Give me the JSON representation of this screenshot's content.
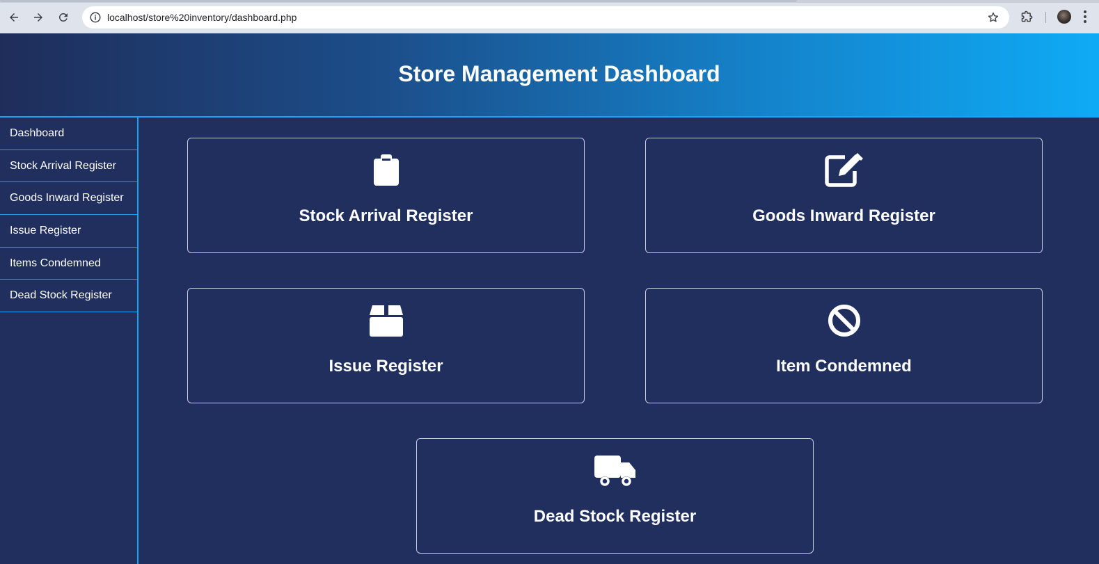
{
  "browser": {
    "url": "localhost/store%20inventory/dashboard.php",
    "icons": {
      "back": "back-arrow-icon",
      "forward": "forward-arrow-icon",
      "reload": "reload-icon",
      "info": "info-icon",
      "bookmark": "star-icon",
      "extensions": "puzzle-icon",
      "menu": "kebab-menu-icon"
    }
  },
  "header": {
    "title": "Store Management Dashboard"
  },
  "sidebar": {
    "items": [
      {
        "label": "Dashboard"
      },
      {
        "label": "Stock Arrival Register"
      },
      {
        "label": "Goods Inward Register"
      },
      {
        "label": "Issue Register"
      },
      {
        "label": "Items Condemned"
      },
      {
        "label": "Dead Stock Register"
      }
    ]
  },
  "cards": [
    {
      "title": "Stock Arrival Register",
      "icon": "clipboard-icon"
    },
    {
      "title": "Goods Inward Register",
      "icon": "edit-icon"
    },
    {
      "title": "Issue Register",
      "icon": "box-icon"
    },
    {
      "title": "Item Condemned",
      "icon": "ban-icon"
    },
    {
      "title": "Dead Stock Register",
      "icon": "truck-icon"
    }
  ],
  "colors": {
    "background": "#202f5e",
    "accent": "#1aa3f0",
    "header_gradient_start": "#1f2d5a",
    "header_gradient_end": "#0faaf5",
    "text": "#ffffff"
  }
}
